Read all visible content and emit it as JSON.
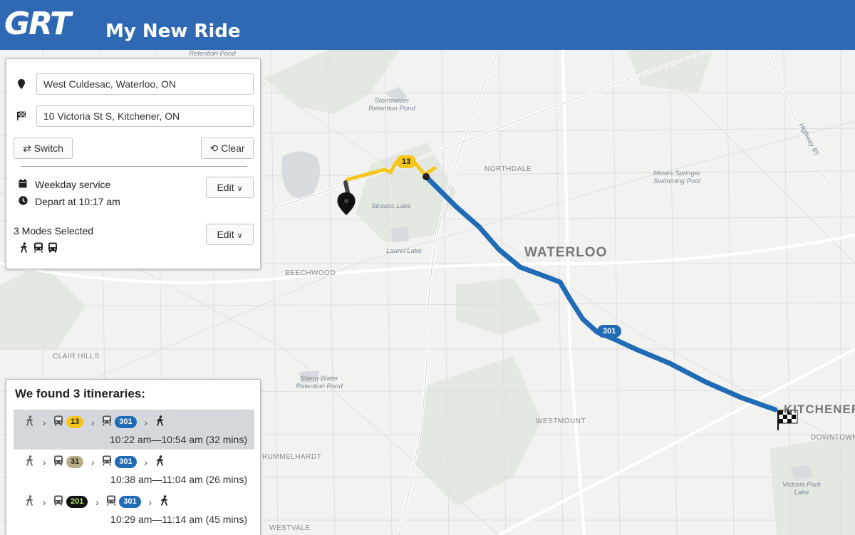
{
  "header": {
    "logo_text": "GRT",
    "title": "My New Ride",
    "background": "#2f69b3"
  },
  "search": {
    "origin_icon": "map-marker-icon",
    "origin_value": "West Culdesac, Waterloo, ON",
    "destination_icon": "checkered-flag-icon",
    "destination_value": "10 Victoria St S, Kitchener, ON",
    "switch_label": "Switch",
    "clear_label": "Clear"
  },
  "schedule": {
    "service_icon": "calendar-icon",
    "service_label": "Weekday service",
    "depart_icon": "clock-icon",
    "depart_label": "Depart at 10:17 am",
    "edit_label": "Edit"
  },
  "modes": {
    "label": "3 Modes Selected",
    "edit_label": "Edit",
    "icons": [
      "walk-icon",
      "train-icon",
      "bus-icon"
    ]
  },
  "results": {
    "title": "We found 3 itineraries:",
    "itineraries": [
      {
        "selected": true,
        "legs": [
          {
            "type": "walk"
          },
          {
            "type": "bus",
            "route": "13",
            "color": "#f5c518",
            "text_color": "#222222"
          },
          {
            "type": "train",
            "route": "301",
            "color": "#1f6bb5",
            "text_color": "#ffffff"
          },
          {
            "type": "walk_end"
          }
        ],
        "time": "10:22 am—10:54 am (32 mins)"
      },
      {
        "selected": false,
        "legs": [
          {
            "type": "walk"
          },
          {
            "type": "bus",
            "route": "31",
            "color": "#b7ad88",
            "text_color": "#222222"
          },
          {
            "type": "train",
            "route": "301",
            "color": "#1f6bb5",
            "text_color": "#ffffff"
          },
          {
            "type": "walk_end"
          }
        ],
        "time": "10:38 am—11:04 am (26 mins)"
      },
      {
        "selected": false,
        "legs": [
          {
            "type": "walk"
          },
          {
            "type": "bus",
            "route": "201",
            "color": "#111111",
            "text_color": "#b6e36a"
          },
          {
            "type": "train",
            "route": "301",
            "color": "#1f6bb5",
            "text_color": "#ffffff"
          },
          {
            "type": "walk_end"
          }
        ],
        "time": "10:29 am—11:14 am (45 mins)"
      }
    ]
  },
  "map": {
    "labels": {
      "retention_top": "Retention Pond",
      "stormwater_1": "Stormwater Retention Pond",
      "northdale": "NORTHDALE",
      "moses_springer": "Moses Springer Swimming Pool",
      "highway_85": "Highway 85",
      "strauss_lake": "Strauss Lake",
      "laurel_lake": "Laurel Lake",
      "waterloo": "WATERLOO",
      "beechwood": "BEECHWOOD",
      "clair_hills": "CLAIR HILLS",
      "storm_water": "Storm Water Retention Pond",
      "westmount": "WESTMOUNT",
      "kitchener": "KITCHENER",
      "downtown": "DOWNTOWN",
      "victoria_park": "Victoria Park Lake",
      "rummelhardt": "RUMMELHARDT",
      "westvale": "WESTVALE"
    },
    "route_badges": [
      {
        "route": "13",
        "color": "#f5c518",
        "text_color": "#222222"
      },
      {
        "route": "301",
        "color": "#1f6bb5",
        "text_color": "#ffffff"
      }
    ],
    "bus_route_color": "#f5c518",
    "train_route_color": "#1f6bb5"
  }
}
